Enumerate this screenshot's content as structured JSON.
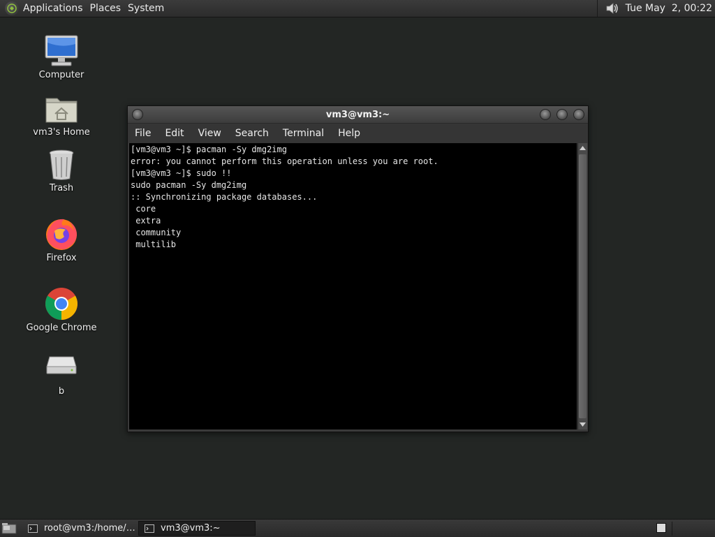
{
  "top_panel": {
    "menus": [
      "Applications",
      "Places",
      "System"
    ],
    "clock": "Tue May  2, 00:22"
  },
  "desktop": {
    "icons": [
      {
        "label": "Computer",
        "icon": "computer-icon"
      },
      {
        "label": "vm3's Home",
        "icon": "home-folder-icon"
      },
      {
        "label": "Trash",
        "icon": "trash-icon"
      },
      {
        "label": "Firefox",
        "icon": "firefox-icon"
      },
      {
        "label": "Google Chrome",
        "icon": "chrome-icon"
      },
      {
        "label": "b",
        "icon": "drive-icon"
      }
    ]
  },
  "terminal": {
    "title": "vm3@vm3:~",
    "menu": [
      "File",
      "Edit",
      "View",
      "Search",
      "Terminal",
      "Help"
    ],
    "output": "[vm3@vm3 ~]$ pacman -Sy dmg2img\nerror: you cannot perform this operation unless you are root.\n[vm3@vm3 ~]$ sudo !!\nsudo pacman -Sy dmg2img\n:: Synchronizing package databases...\n core\n extra\n community\n multilib"
  },
  "taskbar": {
    "tasks": [
      {
        "label": "root@vm3:/home/v…",
        "active": false
      },
      {
        "label": "vm3@vm3:~",
        "active": true
      }
    ]
  },
  "colors": {
    "desktop_bg": "#232624",
    "panel_bg": "#333333",
    "terminal_bg": "#000000",
    "terminal_fg": "#e6e6e6"
  }
}
